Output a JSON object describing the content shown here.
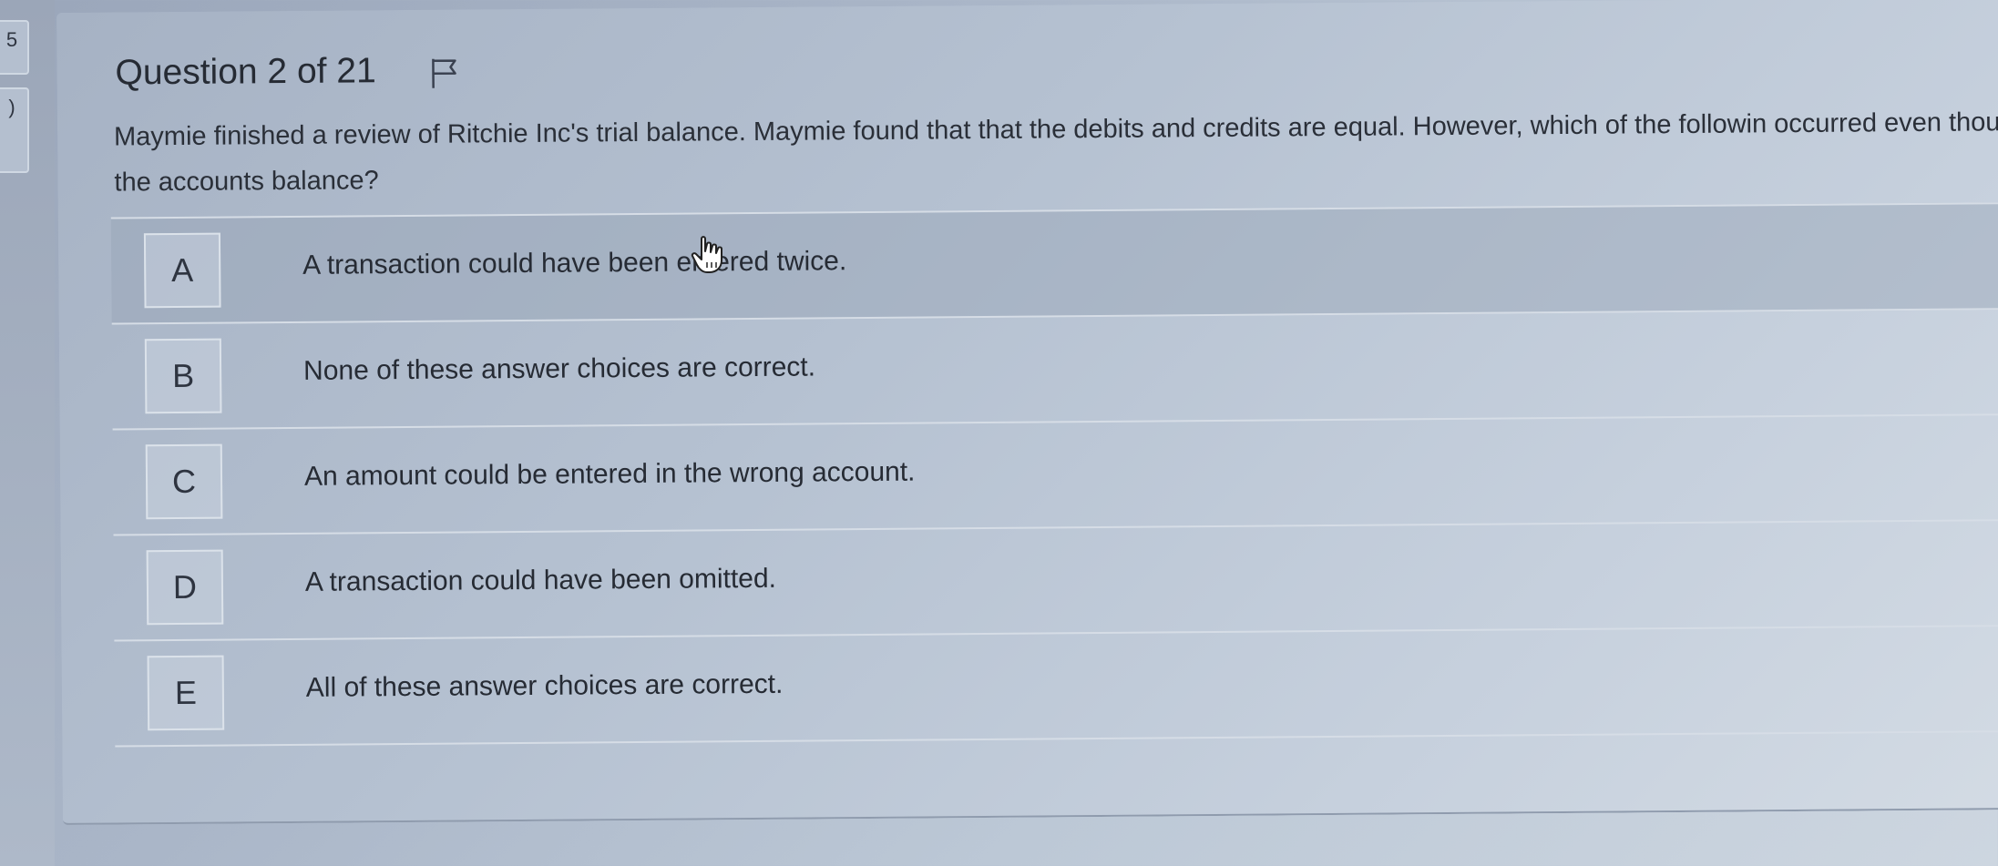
{
  "left_rail": {
    "tab1_label": "5",
    "tab2_label": ")"
  },
  "question": {
    "title": "Question 2 of 21",
    "prompt": "Maymie finished a review of Ritchie Inc's trial balance. Maymie found that that the debits and credits are equal. However, which of the followin occurred even though the accounts balance?"
  },
  "options": [
    {
      "letter": "A",
      "text": "A transaction could have been entered twice.",
      "hovered": true
    },
    {
      "letter": "B",
      "text": "None of these answer choices are correct.",
      "hovered": false
    },
    {
      "letter": "C",
      "text": "An amount could be entered in the wrong account.",
      "hovered": false
    },
    {
      "letter": "D",
      "text": "A transaction could have been omitted.",
      "hovered": false
    },
    {
      "letter": "E",
      "text": "All of these answer choices are correct.",
      "hovered": false
    }
  ],
  "icons": {
    "flag": "flag-icon",
    "cursor": "hand-pointer-icon"
  }
}
